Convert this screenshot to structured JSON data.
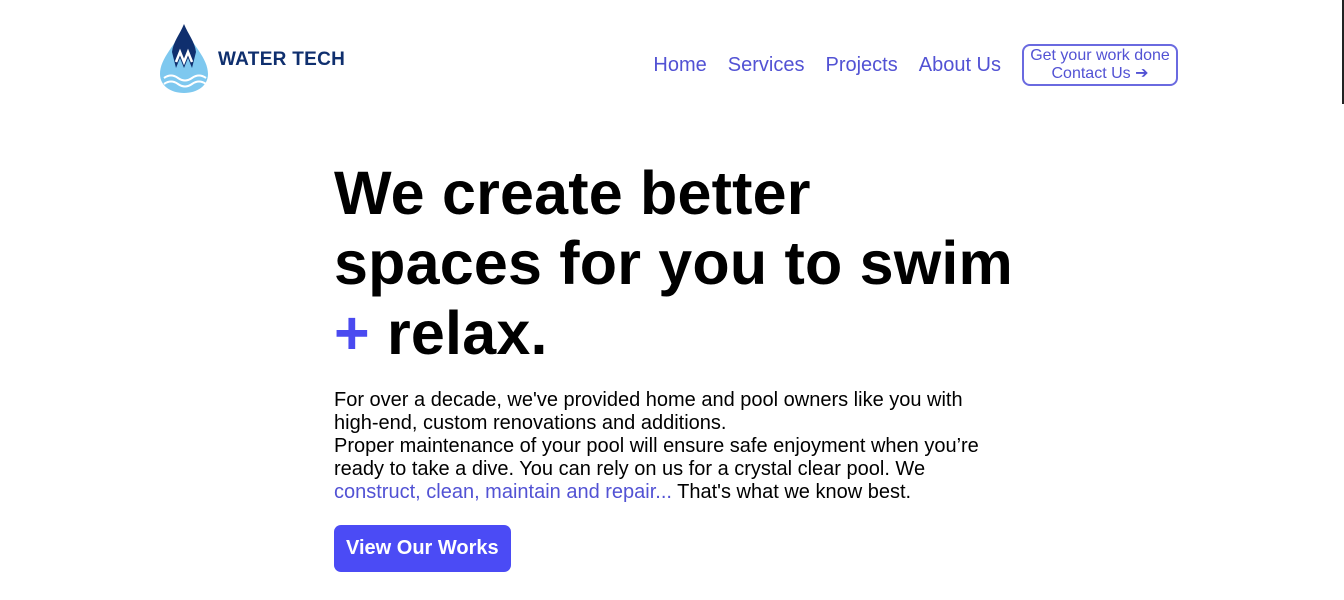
{
  "brand": {
    "name": "WATER TECH",
    "logo_icon": "water-drop-w-icon",
    "colors": {
      "dark_blue": "#0f2f6e",
      "light_blue": "#6fc3ef"
    }
  },
  "nav": {
    "items": [
      {
        "label": "Home"
      },
      {
        "label": "Services"
      },
      {
        "label": "Projects"
      },
      {
        "label": "About Us"
      }
    ],
    "cta": {
      "line1": "Get your work done",
      "line2": "Contact Us",
      "icon": "arrow-right-icon",
      "arrow": "➔"
    }
  },
  "hero": {
    "title_line1": "We create better",
    "title_line2": "spaces for you to swim",
    "title_plus": "+",
    "title_line3": " relax.",
    "desc_line1": "For over a decade, we've provided home and pool owners like you with high-end, custom renovations and additions.",
    "desc_line2": "Proper maintenance of your pool will ensure safe enjoyment when you’re ready to take a dive. You can rely on us for a crystal clear pool. We ",
    "desc_highlight": "construct, clean, maintain and repair...",
    "desc_end": " That's what we know best.",
    "button_label": "View Our Works"
  },
  "colors": {
    "accent": "#4b4bf5",
    "link": "#5252d4"
  }
}
